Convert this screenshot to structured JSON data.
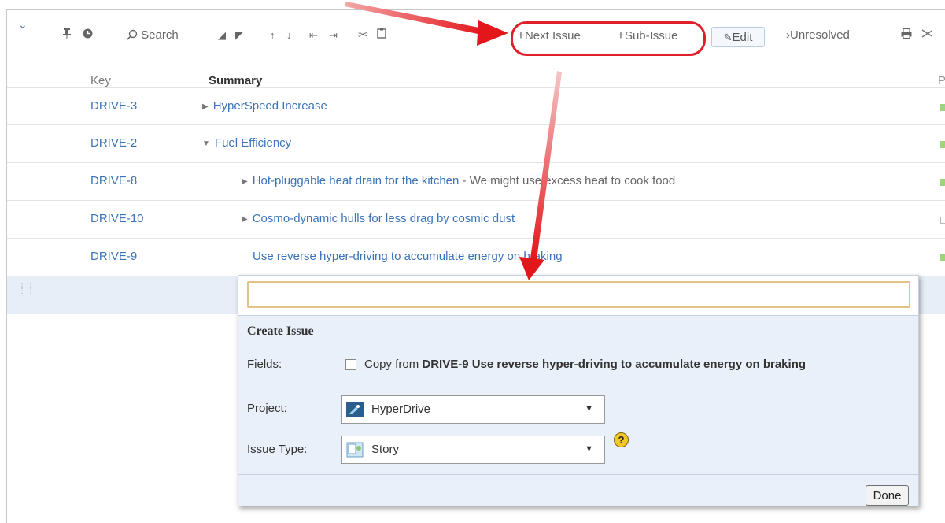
{
  "toolbar": {
    "search_label": "Search",
    "next_issue_label": "Next Issue",
    "sub_issue_label": "Sub-Issue",
    "edit_label": "Edit",
    "unresolved_label": "Unresolved",
    "plus_glyph": "+",
    "edit_glyph": "✎",
    "unresolved_glyph": "›"
  },
  "columns": {
    "key": "Key",
    "summary": "Summary",
    "priority": "P"
  },
  "rows": [
    {
      "key": "DRIVE-3",
      "summary": "HyperSpeed Increase",
      "description": "",
      "expander": "▶",
      "priority": "filled"
    },
    {
      "key": "DRIVE-2",
      "summary": "Fuel Efficiency",
      "description": "",
      "expander": "▼",
      "priority": "filled"
    },
    {
      "key": "DRIVE-8",
      "summary": "Hot-pluggable heat drain for the kitchen",
      "description": " - We might use excess heat to cook food",
      "expander": "▶",
      "priority": "filled"
    },
    {
      "key": "DRIVE-10",
      "summary": "Cosmo-dynamic hulls for less drag by cosmic dust",
      "description": "",
      "expander": "▶",
      "priority": "empty"
    },
    {
      "key": "DRIVE-9",
      "summary": "Use reverse hyper-driving to accumulate energy on braking",
      "description": "",
      "expander": "",
      "priority": "filled"
    }
  ],
  "create_issue": {
    "summary_value": "",
    "title": "Create Issue",
    "fields_label": "Fields:",
    "copy_prefix": "Copy from ",
    "copy_key_summary": "DRIVE-9 Use reverse hyper-driving to accumulate energy on braking",
    "project_label": "Project:",
    "project_value": "HyperDrive",
    "issue_type_label": "Issue Type:",
    "issue_type_value": "Story",
    "help_glyph": "?",
    "done_label": "Done"
  },
  "colors": {
    "link": "#3b73b9",
    "highlight": "#e01f2a",
    "priority_green": "#9ed47e",
    "input_border": "#e2c285",
    "popup_bg": "#eaf0f9"
  },
  "icons": [
    "chevron-down-icon",
    "pin-icon",
    "clock-icon",
    "search-icon",
    "move-left-icon",
    "move-right-icon",
    "move-up-icon",
    "move-down-icon",
    "outdent-icon",
    "indent-icon",
    "cut-icon",
    "paste-icon",
    "pencil-icon",
    "print-icon",
    "settings-icon",
    "project-icon",
    "story-icon",
    "help-icon",
    "drag-handle-icon"
  ]
}
